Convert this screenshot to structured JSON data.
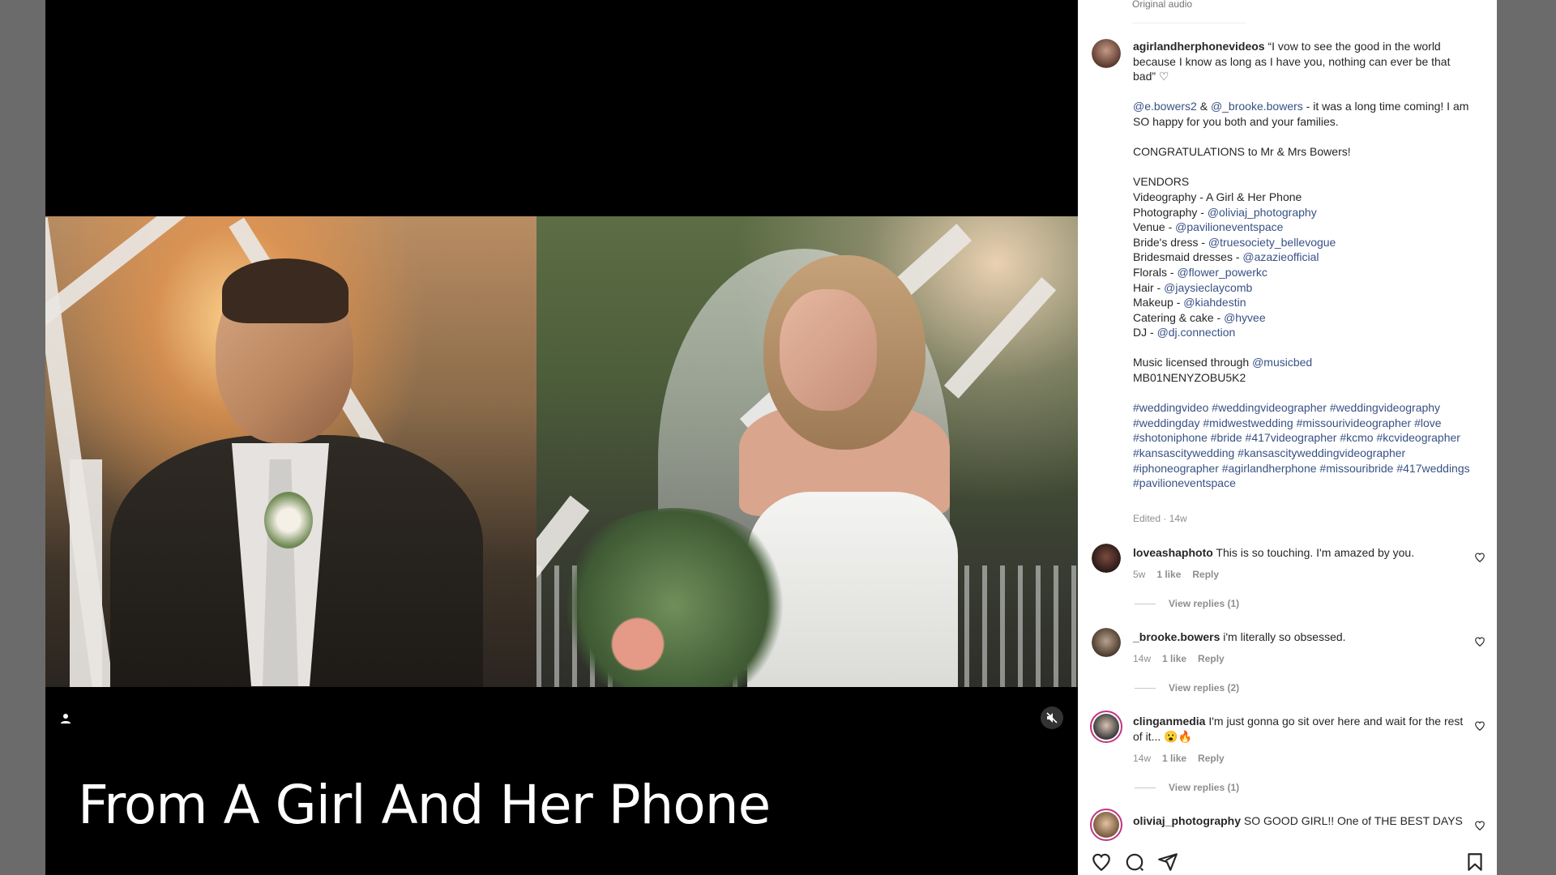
{
  "video": {
    "caption": "From A Girl And Her Phone",
    "icons": {
      "user": "user-icon",
      "mute": "speaker-muted-icon"
    }
  },
  "sidebar": {
    "audio_label": "Original audio",
    "post": {
      "username": "agirlandherphonevideos",
      "quote": " “I vow to see the good in the world because I know as long as I have you, nothing can ever be that bad” ♡",
      "mention1": "@e.bowers2",
      "amp": " & ",
      "mention2": "@_brooke.bowers",
      "thanks": " - it was a long time coming! I am SO happy for you both and your families.",
      "congrats": "CONGRATULATIONS to Mr & Mrs Bowers!",
      "vendors_heading": "VENDORS",
      "vendors": [
        {
          "role": "Videography - A Girl & Her Phone",
          "handle": ""
        },
        {
          "role": "Photography - ",
          "handle": "@oliviaj_photography"
        },
        {
          "role": "Venue - ",
          "handle": "@pavilioneventspace"
        },
        {
          "role": "Bride's dress - ",
          "handle": "@truesociety_bellevogue"
        },
        {
          "role": "Bridesmaid dresses - ",
          "handle": "@azazieofficial"
        },
        {
          "role": "Florals - ",
          "handle": "@flower_powerkc"
        },
        {
          "role": "Hair - ",
          "handle": "@jaysieclaycomb"
        },
        {
          "role": "Makeup - ",
          "handle": "@kiahdestin"
        },
        {
          "role": "Catering & cake - ",
          "handle": "@hyvee"
        },
        {
          "role": "DJ - ",
          "handle": "@dj.connection"
        }
      ],
      "music_text": "Music licensed through ",
      "music_handle": "@musicbed",
      "music_code": "MB01NENYZOBU5K2",
      "hashtags": "#weddingvideo #weddingvideographer #weddingvideography #weddingday #midwestwedding #missourivideographer #love #shotoniphone #bride #417videographer #kcmo #kcvideographer #kansascitywedding #kansascityweddingvideographer #iphoneographer #agirlandherphone #missouribride #417weddings #pavilioneventspace",
      "edited": "Edited · 14w"
    },
    "comments": [
      {
        "user": "loveashaphoto",
        "text": " This is so touching. I'm amazed by you.",
        "age": "5w",
        "likes": "1 like",
        "reply": "Reply",
        "view_replies": "View replies (1)"
      },
      {
        "user": "_brooke.bowers",
        "text": " i'm literally so obsessed.",
        "age": "14w",
        "likes": "1 like",
        "reply": "Reply",
        "view_replies": "View replies (2)"
      },
      {
        "user": "clinganmedia",
        "text": " I'm just gonna go sit over here and wait for the rest of it... 😮🔥",
        "age": "14w",
        "likes": "1 like",
        "reply": "Reply",
        "view_replies": "View replies (1)"
      },
      {
        "user": "oliviaj_photography",
        "text": " SO GOOD GIRL!! One of THE BEST DAYS",
        "age": "",
        "likes": "",
        "reply": "",
        "view_replies": ""
      }
    ],
    "action_icons": [
      "heart-icon",
      "comment-icon",
      "share-icon",
      "bookmark-icon"
    ]
  }
}
